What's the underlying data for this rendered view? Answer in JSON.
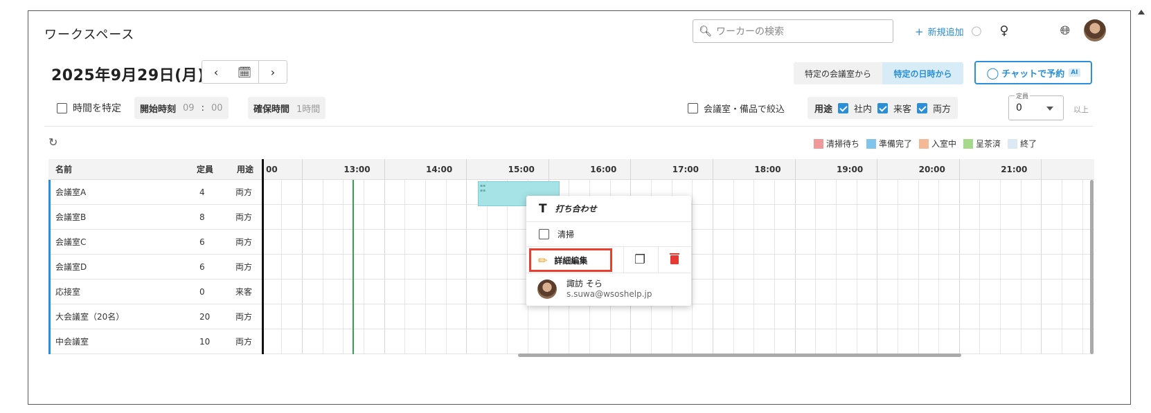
{
  "app": {
    "title": "ワークスペース"
  },
  "header": {
    "search_placeholder": "ワーカーの検索",
    "add_new_label": "新規追加"
  },
  "date_nav": {
    "date_label": "2025年9月29日(月)",
    "prev": "‹",
    "next": "›"
  },
  "mode": {
    "from_room": "特定の会議室から",
    "from_date": "特定の日時から",
    "chat_book": "チャットで予約",
    "ai_badge": "AI"
  },
  "filters": {
    "time_spec_label": "時間を特定",
    "start_time_label": "開始時刻",
    "start_hour": "09",
    "colon": ":",
    "start_min": "00",
    "keep_time_label": "確保時間",
    "keep_time_value": "1時間",
    "narrow_label": "会議室・備品で絞込",
    "use_label": "用途",
    "use_internal": "社内",
    "use_visitor": "来客",
    "use_both": "両方",
    "capacity_legend": "定員",
    "capacity_value": "0",
    "capacity_suffix": "以上"
  },
  "legend": [
    {
      "label": "清掃待ち",
      "color": "#ef9a9a"
    },
    {
      "label": "準備完了",
      "color": "#81c4ee"
    },
    {
      "label": "入室中",
      "color": "#f5b996"
    },
    {
      "label": "呈茶済",
      "color": "#a5d98a"
    },
    {
      "label": "終了",
      "color": "#dde8f5"
    }
  ],
  "table": {
    "headers": {
      "name": "名前",
      "capacity": "定員",
      "use": "用途"
    },
    "time_columns": [
      "00",
      "13:00",
      "14:00",
      "15:00",
      "16:00",
      "17:00",
      "18:00",
      "19:00",
      "20:00",
      "21:00"
    ],
    "rows": [
      {
        "name": "会議室A",
        "capacity": "4",
        "use": "両方"
      },
      {
        "name": "会議室B",
        "capacity": "8",
        "use": "両方"
      },
      {
        "name": "会議室C",
        "capacity": "6",
        "use": "両方"
      },
      {
        "name": "会議室D",
        "capacity": "6",
        "use": "両方"
      },
      {
        "name": "応接室",
        "capacity": "0",
        "use": "来客"
      },
      {
        "name": "大会議室（20名）",
        "capacity": "20",
        "use": "両方"
      },
      {
        "name": "中会議室",
        "capacity": "10",
        "use": "両方"
      }
    ]
  },
  "popup": {
    "title": "打ち合わせ",
    "cleaning_label": "清掃",
    "edit_label": "詳細編集",
    "user_name": "諏訪 そら",
    "user_email": "s.suwa@wsoshelp.jp"
  }
}
